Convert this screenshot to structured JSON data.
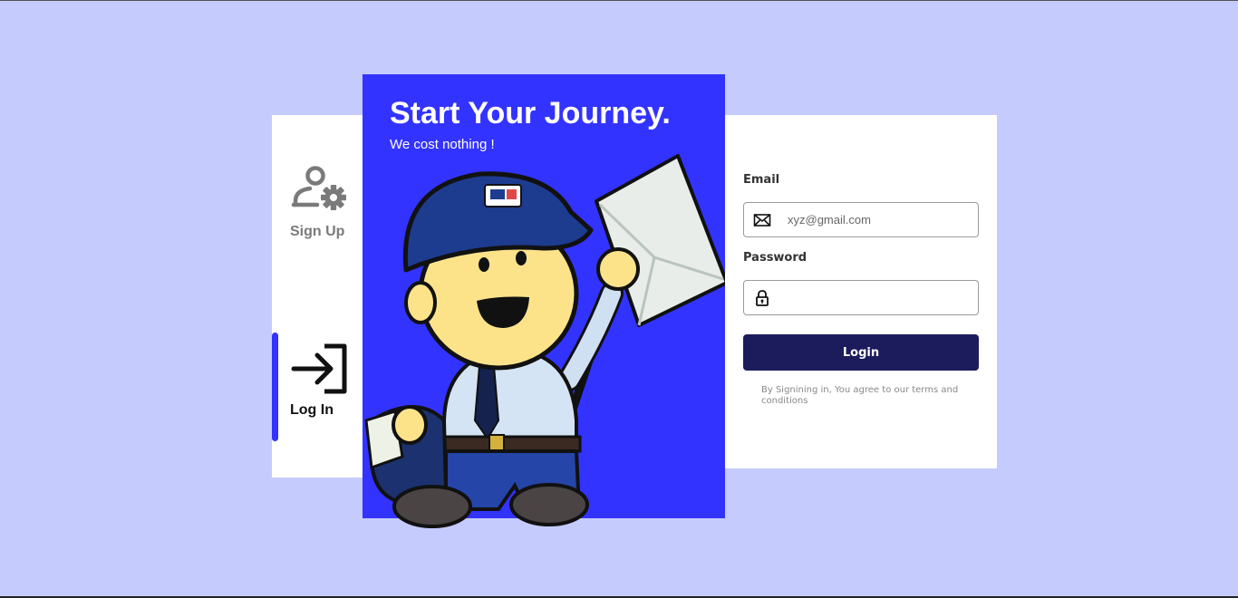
{
  "nav": {
    "signup": {
      "label": "Sign Up",
      "icon": "user-gear-icon"
    },
    "login": {
      "label": "Log In",
      "icon": "login-arrow-icon",
      "active": true
    }
  },
  "hero": {
    "title": "Start Your Journey.",
    "subtitle": "We cost nothing !",
    "illustration": "mail-carrier-mascot"
  },
  "form": {
    "email_label": "Email",
    "email_placeholder": "xyz@gmail.com",
    "email_value": "",
    "email_icon": "envelope-icon",
    "password_label": "Password",
    "password_placeholder": "",
    "password_value": "",
    "password_icon": "lock-icon",
    "login_button": "Login",
    "terms": "By Signining in, You agree to our terms and conditions"
  },
  "colors": {
    "page_background": "#c5cbfd",
    "accent": "#3333ff",
    "button": "#1c1c5c",
    "panel": "#ffffff"
  }
}
